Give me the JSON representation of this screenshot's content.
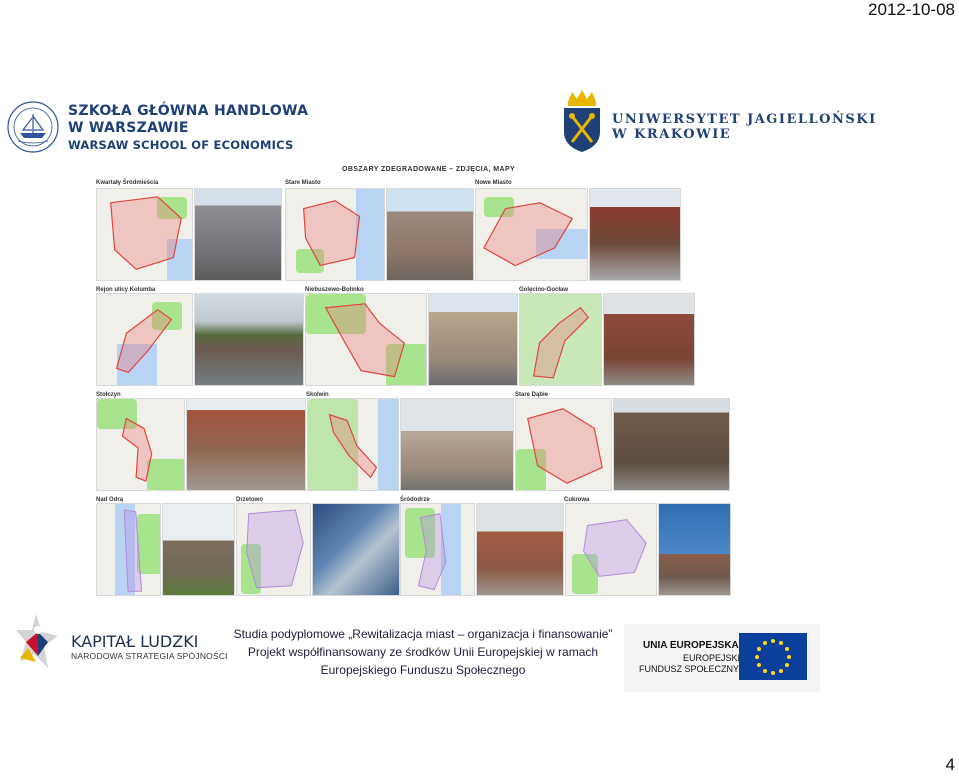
{
  "header": {
    "date": "2012-10-08"
  },
  "logos": {
    "sgh": {
      "line1": "SZKOŁA GŁÓWNA HANDLOWA",
      "line2": "W WARSZAWIE",
      "line3": "WARSAW SCHOOL OF ECONOMICS"
    },
    "uj": {
      "line1": "UNIWERSYTET JAGIELLOŃSKI",
      "line2": "W KRAKOWIE"
    }
  },
  "collage": {
    "title": "OBSZARY ZDEGRADOWANE – ZDJĘCIA, MAPY",
    "areas": [
      "Kwartały Śródmieścia",
      "Stare Miasto",
      "Nowe Miasto",
      "Rejon ulicy Kolumba",
      "Niebuszewo-Bolinko",
      "Golęcino-Gocław",
      "Stołczyn",
      "Skolwin",
      "Stare Dąbie",
      "Nad Odrą",
      "Drzetowo",
      "Śródodrze",
      "Cukrowa"
    ]
  },
  "footer": {
    "kapital_title": "KAPITAŁ LUDZKI",
    "kapital_sub": "NARODOWA STRATEGIA SPÓJNOŚCI",
    "line1": "Studia podyplomowe „Rewitalizacja miast – organizacja i finansowanie”",
    "line2": "Projekt współfinansowany ze środków Unii Europejskiej w ramach",
    "line3": "Europejskiego Funduszu Społecznego",
    "ue_title": "UNIA EUROPEJSKA",
    "ue_line2": "EUROPEJSKI",
    "ue_line3": "FUNDUSZ SPOŁECZNY"
  },
  "page_number": "4",
  "colors": {
    "navy": "#1f3f77",
    "eu_blue": "#0c3f9c",
    "eu_gold": "#ffdd00",
    "map_green": "#a8e38e",
    "map_outline": "#e0453c"
  }
}
